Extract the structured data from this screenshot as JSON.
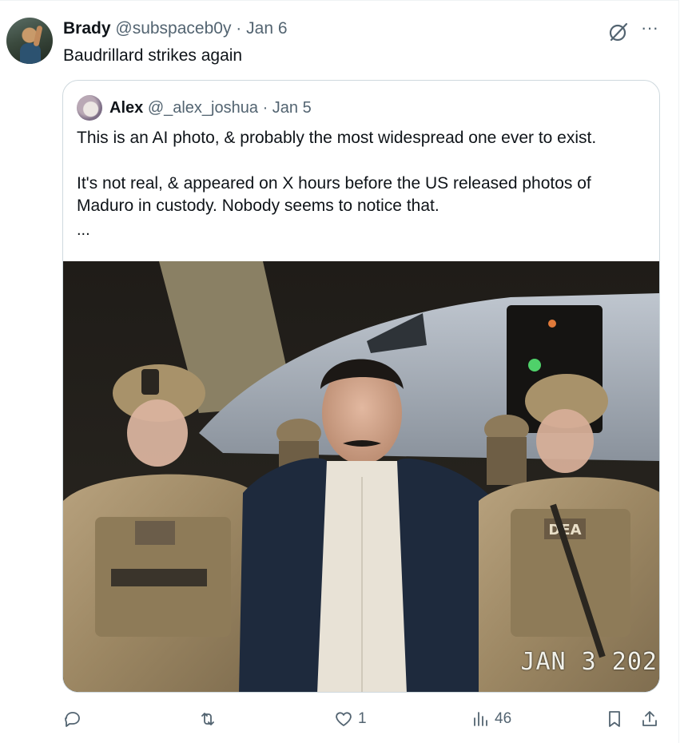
{
  "tweet": {
    "author_name": "Brady",
    "author_handle": "@subspaceb0y",
    "separator": "·",
    "date": "Jan 6",
    "text": "Baudrillard strikes again",
    "icons": {
      "grok": "grok-icon",
      "more": "more-icon"
    },
    "more_glyph": "···"
  },
  "quote": {
    "author_name": "Alex",
    "author_handle": "@_alex_joshua",
    "separator": "·",
    "date": "Jan 5",
    "paragraph_1": "This is an AI photo, & probably the most widespread one ever to exist.",
    "paragraph_2": "It's not real, & appeared on X hours before the US released photos of Maduro in custody. Nobody seems to notice that.",
    "ellipsis": "...",
    "image": {
      "date_stamp": "JAN  3 202",
      "vest_patch_text": "DEA"
    }
  },
  "actions": {
    "reply": {
      "icon": "reply-icon"
    },
    "repost": {
      "icon": "repost-icon"
    },
    "like": {
      "icon": "heart-icon",
      "count": "1"
    },
    "views": {
      "icon": "views-icon",
      "count": "46"
    },
    "bookmark": {
      "icon": "bookmark-icon"
    },
    "share": {
      "icon": "share-icon"
    }
  },
  "colors": {
    "text_primary": "#0f1419",
    "text_secondary": "#536471",
    "border": "#cfd9de"
  }
}
